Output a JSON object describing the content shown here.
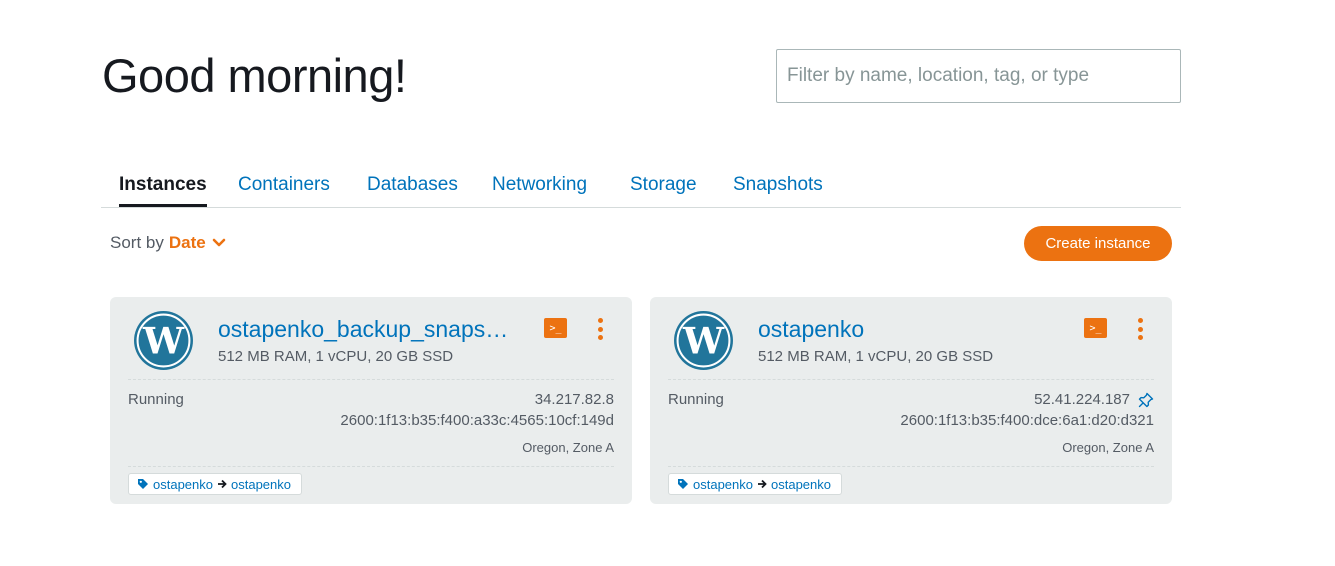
{
  "page": {
    "greeting": "Good morning!"
  },
  "filter": {
    "placeholder": "Filter by name, location, tag, or type",
    "value": ""
  },
  "tabs": [
    {
      "label": "Instances",
      "active": true
    },
    {
      "label": "Containers",
      "active": false
    },
    {
      "label": "Databases",
      "active": false
    },
    {
      "label": "Networking",
      "active": false
    },
    {
      "label": "Storage",
      "active": false
    },
    {
      "label": "Snapshots",
      "active": false
    }
  ],
  "sort": {
    "label": "Sort by",
    "value": "Date"
  },
  "create_button": "Create instance",
  "instances": [
    {
      "name": "ostapenko_backup_snaps…",
      "spec": "512 MB RAM, 1 vCPU, 20 GB SSD",
      "status": "Running",
      "ipv4": "34.217.82.8",
      "ipv6": "2600:1f13:b35:f400:a33c:4565:10cf:149d",
      "zone": "Oregon, Zone A",
      "tag_key": "ostapenko",
      "tag_value": "ostapenko",
      "pinned": false
    },
    {
      "name": "ostapenko",
      "spec": "512 MB RAM, 1 vCPU, 20 GB SSD",
      "status": "Running",
      "ipv4": "52.41.224.187",
      "ipv6": "2600:1f13:b35:f400:dce:6a1:d20:d321",
      "zone": "Oregon, Zone A",
      "tag_key": "ostapenko",
      "tag_value": "ostapenko",
      "pinned": true
    }
  ],
  "icons": {
    "logo": "wordpress-icon",
    "terminal": "terminal-icon",
    "menu": "kebab-menu-icon",
    "pin": "pin-icon",
    "tag": "tag-icon",
    "arrow": "arrow-right-icon",
    "sort": "chevron-down-icon"
  },
  "colors": {
    "accent": "#ec7211",
    "link": "#0073bb",
    "card_bg": "#eaeded",
    "text": "#16191f",
    "muted": "#545b64"
  }
}
